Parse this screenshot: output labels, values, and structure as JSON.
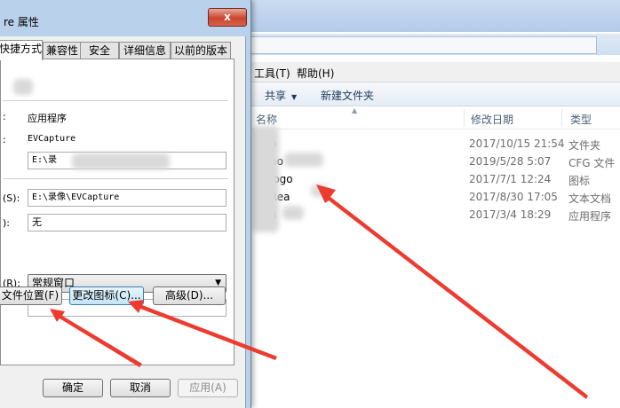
{
  "explorer": {
    "menu": {
      "tools": "工具(T)",
      "help": "帮助(H)"
    },
    "toolbar": {
      "share": "共享",
      "new_folder": "新建文件夹"
    },
    "columns": {
      "name": "名称",
      "date": "修改日期",
      "type": "类型"
    },
    "rows": [
      {
        "name": "b",
        "date": "2017/10/15 21:54",
        "type": "文件夹"
      },
      {
        "name": "ho",
        "date": "2019/5/28 5:07",
        "type": "CFG 文件"
      },
      {
        "name": "logo",
        "date": "2017/7/1 12:24",
        "type": "图标"
      },
      {
        "name": "Rea",
        "date": "2017/8/30 17:05",
        "type": "文本文档"
      },
      {
        "name": "u",
        "date": "2017/3/4 18:29",
        "type": "应用程序"
      }
    ]
  },
  "dialog": {
    "title": "re 属性",
    "close_label": "x",
    "tabs": [
      "快捷方式",
      "兼容性",
      "安全",
      "详细信息",
      "以前的版本"
    ],
    "fields": {
      "target_type_label": ":",
      "target_type_value": "应用程序",
      "target_location_label": ":",
      "target_location_value": "EVCapture",
      "target_value": "E:\\录",
      "start_in_label": "(S):",
      "start_in_value": "E:\\录像\\EVCapture",
      "hotkey_label": "):",
      "hotkey_value": "无",
      "run_label": "(R):",
      "run_value": "常规窗口",
      "comment_value": ""
    },
    "buttons": {
      "open_location": "文件位置(F)",
      "change_icon": "更改图标(C)...",
      "advanced": "高级(D)...",
      "ok": "确定",
      "cancel": "取消",
      "apply": "应用(A)"
    }
  },
  "colors": {
    "arrow": "#ee3b30",
    "close_button": "#c9452f"
  }
}
